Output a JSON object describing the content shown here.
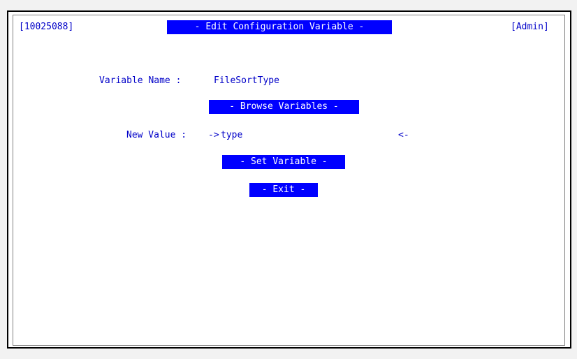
{
  "header": {
    "left_code": "[10025088]",
    "title": "- Edit Configuration Variable -",
    "role": "[Admin]"
  },
  "form": {
    "variable_name_label": "Variable Name :",
    "variable_name_value": "FileSortType",
    "browse_button": "- Browse Variables -",
    "new_value_label": "New Value :",
    "new_value_open": "->",
    "new_value_input": "type",
    "new_value_close": "<-",
    "set_button": "- Set Variable -",
    "exit_button": "- Exit -"
  },
  "colors": {
    "terminal_text": "#0000c8",
    "highlight_bg": "#0000ff",
    "highlight_text": "#ffffff"
  }
}
